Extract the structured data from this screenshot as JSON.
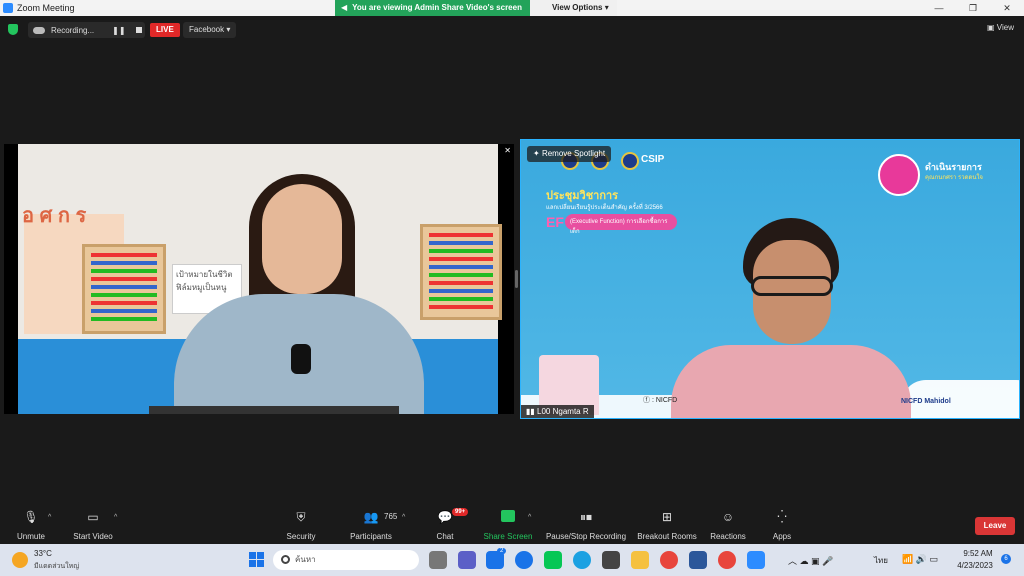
{
  "window": {
    "title": "Zoom Meeting",
    "minimize": "—",
    "maximize": "❐",
    "close": "✕"
  },
  "share_banner": {
    "message": "You are viewing Admin Share Video's screen",
    "view_options": "View Options ▾"
  },
  "topbar": {
    "recording_label": "Recording...",
    "pause_icon": "❚❚",
    "live_label": "LIVE",
    "stream_target": "Facebook ▾",
    "view_label": "View"
  },
  "left_video": {
    "poster_text": "อ ศ ก ร",
    "sign_text": "เป้าหมายในชีวิต ฟิล์มหมูเป็นหนู",
    "close_glyph": "✕"
  },
  "right_video": {
    "remove_spotlight": "Remove Spotlight",
    "csip_label": "CSIP",
    "conf_title": "ประชุมวิชาการ",
    "conf_subtitle": "แลกเปลี่ยนเรียนรู้ประเด็นสำคัญ ครั้งที่ 3/2566",
    "ef_label": "EF",
    "ef_pill": "(Executive Function) การเลือกซื้อการเด็ก",
    "speaker_label": "ดำเนินรายการ",
    "speaker_name": "คุณกนกศรา รวดดนใจ",
    "fb_tag": "NICFD",
    "nicfd_tag": "NICFD Mahidol",
    "participant_name": "L00 Ngamta R"
  },
  "toolbar": {
    "unmute": "Unmute",
    "start_video": "Start Video",
    "security": "Security",
    "participants": "Participants",
    "participants_count": "765",
    "chat": "Chat",
    "chat_badge": "99+",
    "share_screen": "Share Screen",
    "pause_stop_recording": "Pause/Stop Recording",
    "breakout_rooms": "Breakout Rooms",
    "reactions": "Reactions",
    "apps": "Apps",
    "leave": "Leave"
  },
  "taskbar": {
    "temperature": "33°C",
    "weather_desc": "มีแดดส่วนใหญ่",
    "search_placeholder": "ค้นหา",
    "mail_badge": "2",
    "lang": "ไทย",
    "time": "9:52 AM",
    "date": "4/23/2023",
    "notif_count": "6"
  },
  "colors": {
    "share_green": "#23a35a",
    "live_red": "#e02828",
    "leave_red": "#d93636",
    "zoom_blue": "#2d8cff"
  },
  "icons": [
    "shield-icon",
    "cloud-icon",
    "pause-icon",
    "stop-icon",
    "mic-muted-icon",
    "video-off-icon",
    "security-icon",
    "participants-icon",
    "chat-icon",
    "share-icon",
    "recording-icon",
    "breakout-icon",
    "reactions-icon",
    "apps-icon",
    "windows-start-icon",
    "search-icon"
  ]
}
